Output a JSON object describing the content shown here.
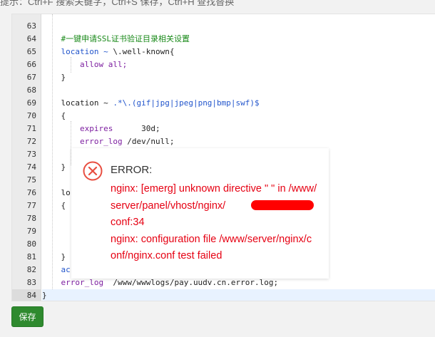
{
  "hint": "提示：Ctrl+F 搜索关键字，Ctrl+S 保存，Ctrl+H 查找替换",
  "editor": {
    "line_numbers": [
      "63",
      "64",
      "65",
      "66",
      "67",
      "68",
      "69",
      "70",
      "71",
      "72",
      "73",
      "74",
      "75",
      "76",
      "77",
      "78",
      "79",
      "80",
      "81",
      "82",
      "83",
      "84"
    ],
    "lines": {
      "l64": "#一键申请SSL证书验证目录相关设置",
      "l65a": "location ~ ",
      "l65b": "\\.well-known{",
      "l66a": "allow",
      "l66b": " all;",
      "l67": "}",
      "l69a": "location ~ ",
      "l69b": ".*\\.(gif|jpg|jpeg|png|bmp|swf)$",
      "l70": "{",
      "l71a": "expires",
      "l71b": "      30d;",
      "l72a": "error_log",
      "l72b": " /dev/null;",
      "l74": "}",
      "l76": "lo",
      "l77": "{",
      "l81": "}",
      "l82": "ac",
      "l83a": "error_log",
      "l83b": "  /www/wwwlogs/pay.uudv.cn.error.log;",
      "l84": "}"
    }
  },
  "save_button": "保存",
  "dialog": {
    "title": "ERROR:",
    "message_1": "nginx: [emerg] unknown directive \" \" in /www/server/panel/vhost/nginx/",
    "message_1_tail": "conf:34",
    "message_2": "nginx: configuration file /www/server/nginx/conf/nginx.conf test failed",
    "icon": "error-circle-x-icon",
    "colors": {
      "error_text": "#e60012",
      "icon": "#e84e40"
    }
  }
}
